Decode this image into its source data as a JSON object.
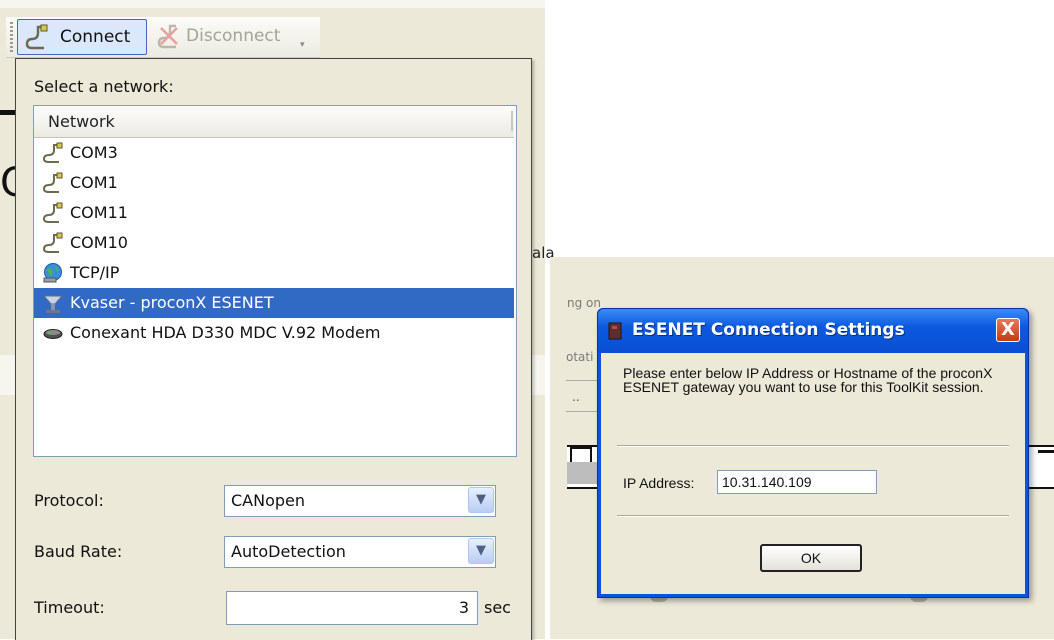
{
  "toolbar": {
    "connect_label": "Connect",
    "disconnect_label": "Disconnect"
  },
  "dropdown": {
    "select_label": "Select a network:",
    "list_header": "Network",
    "networks": [
      {
        "label": "COM3",
        "icon": "serial-cable-icon"
      },
      {
        "label": "COM1",
        "icon": "serial-cable-icon"
      },
      {
        "label": "COM11",
        "icon": "serial-cable-icon"
      },
      {
        "label": "COM10",
        "icon": "serial-cable-icon"
      },
      {
        "label": "TCP/IP",
        "icon": "globe-network-icon"
      },
      {
        "label": "Kvaser - proconX ESENET",
        "icon": "network-adapter-icon",
        "selected": true
      },
      {
        "label": "Conexant HDA D330 MDC V.92 Modem",
        "icon": "modem-icon"
      }
    ],
    "protocol": {
      "label": "Protocol:",
      "value": "CANopen"
    },
    "baud_rate": {
      "label": "Baud Rate:",
      "value": "AutoDetection"
    },
    "timeout": {
      "label": "Timeout:",
      "value": "3",
      "unit": "sec"
    }
  },
  "background_fragments": {
    "right_of_dropdown": "ala",
    "right_panel_1": "ng on",
    "right_panel_2": "otati",
    "right_panel_3": ".."
  },
  "dialog": {
    "title": "ESENET Connection Settings",
    "message": "Please enter below IP Address or Hostname of the proconX ESENET gateway you want to use for this ToolKit session.",
    "ip_label": "IP Address:",
    "ip_value": "10.31.140.109",
    "ok_label": "OK",
    "close_label": "X"
  },
  "colors": {
    "selection": "#316ac5",
    "dialog_title": "#0a54e3",
    "window_face": "#ece9d8"
  }
}
